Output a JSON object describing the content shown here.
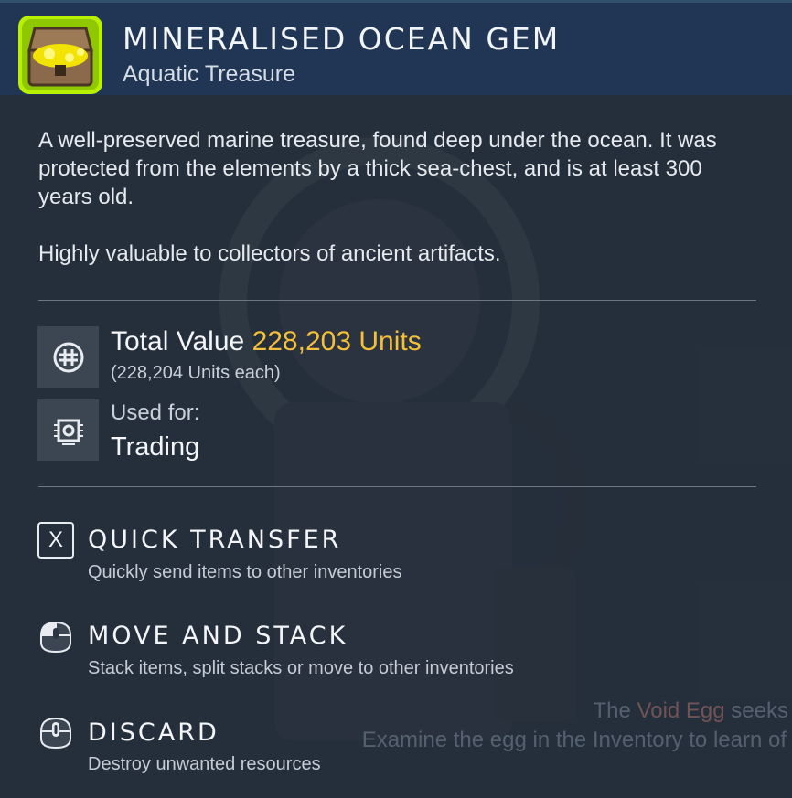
{
  "item": {
    "title": "MINERALISED OCEAN GEM",
    "subtitle": "Aquatic Treasure",
    "icon": "treasure-chest-icon"
  },
  "description": {
    "paragraph1": "A well-preserved marine treasure, found deep under the ocean. It was protected from the elements by a thick sea-chest, and is at least 300 years old.",
    "paragraph2": "Highly valuable to collectors of ancient artifacts."
  },
  "stats": {
    "total_value_label": "Total Value",
    "total_value_amount": "228,203 Units",
    "unit_each": "(228,204 Units each)",
    "used_for_label": "Used for:",
    "used_for_value": "Trading"
  },
  "actions": [
    {
      "key": "X",
      "title": "QUICK TRANSFER",
      "description": "Quickly send items to other inventories",
      "icon": "x-key-icon"
    },
    {
      "title": "MOVE AND STACK",
      "description": "Stack items, split stacks or move to other inventories",
      "icon": "mouse-left-button-icon"
    },
    {
      "title": "DISCARD",
      "description": "Destroy unwanted resources",
      "icon": "mouse-middle-button-icon"
    }
  ],
  "background_notice": {
    "line1_prefix": "The ",
    "line1_highlight": "Void Egg",
    "line1_suffix": " seeks",
    "line2": "Examine the egg in the Inventory to learn of"
  },
  "colors": {
    "header_bg": "#203654",
    "value_accent": "#f5bf3a",
    "icon_glow": "#b8f000"
  }
}
